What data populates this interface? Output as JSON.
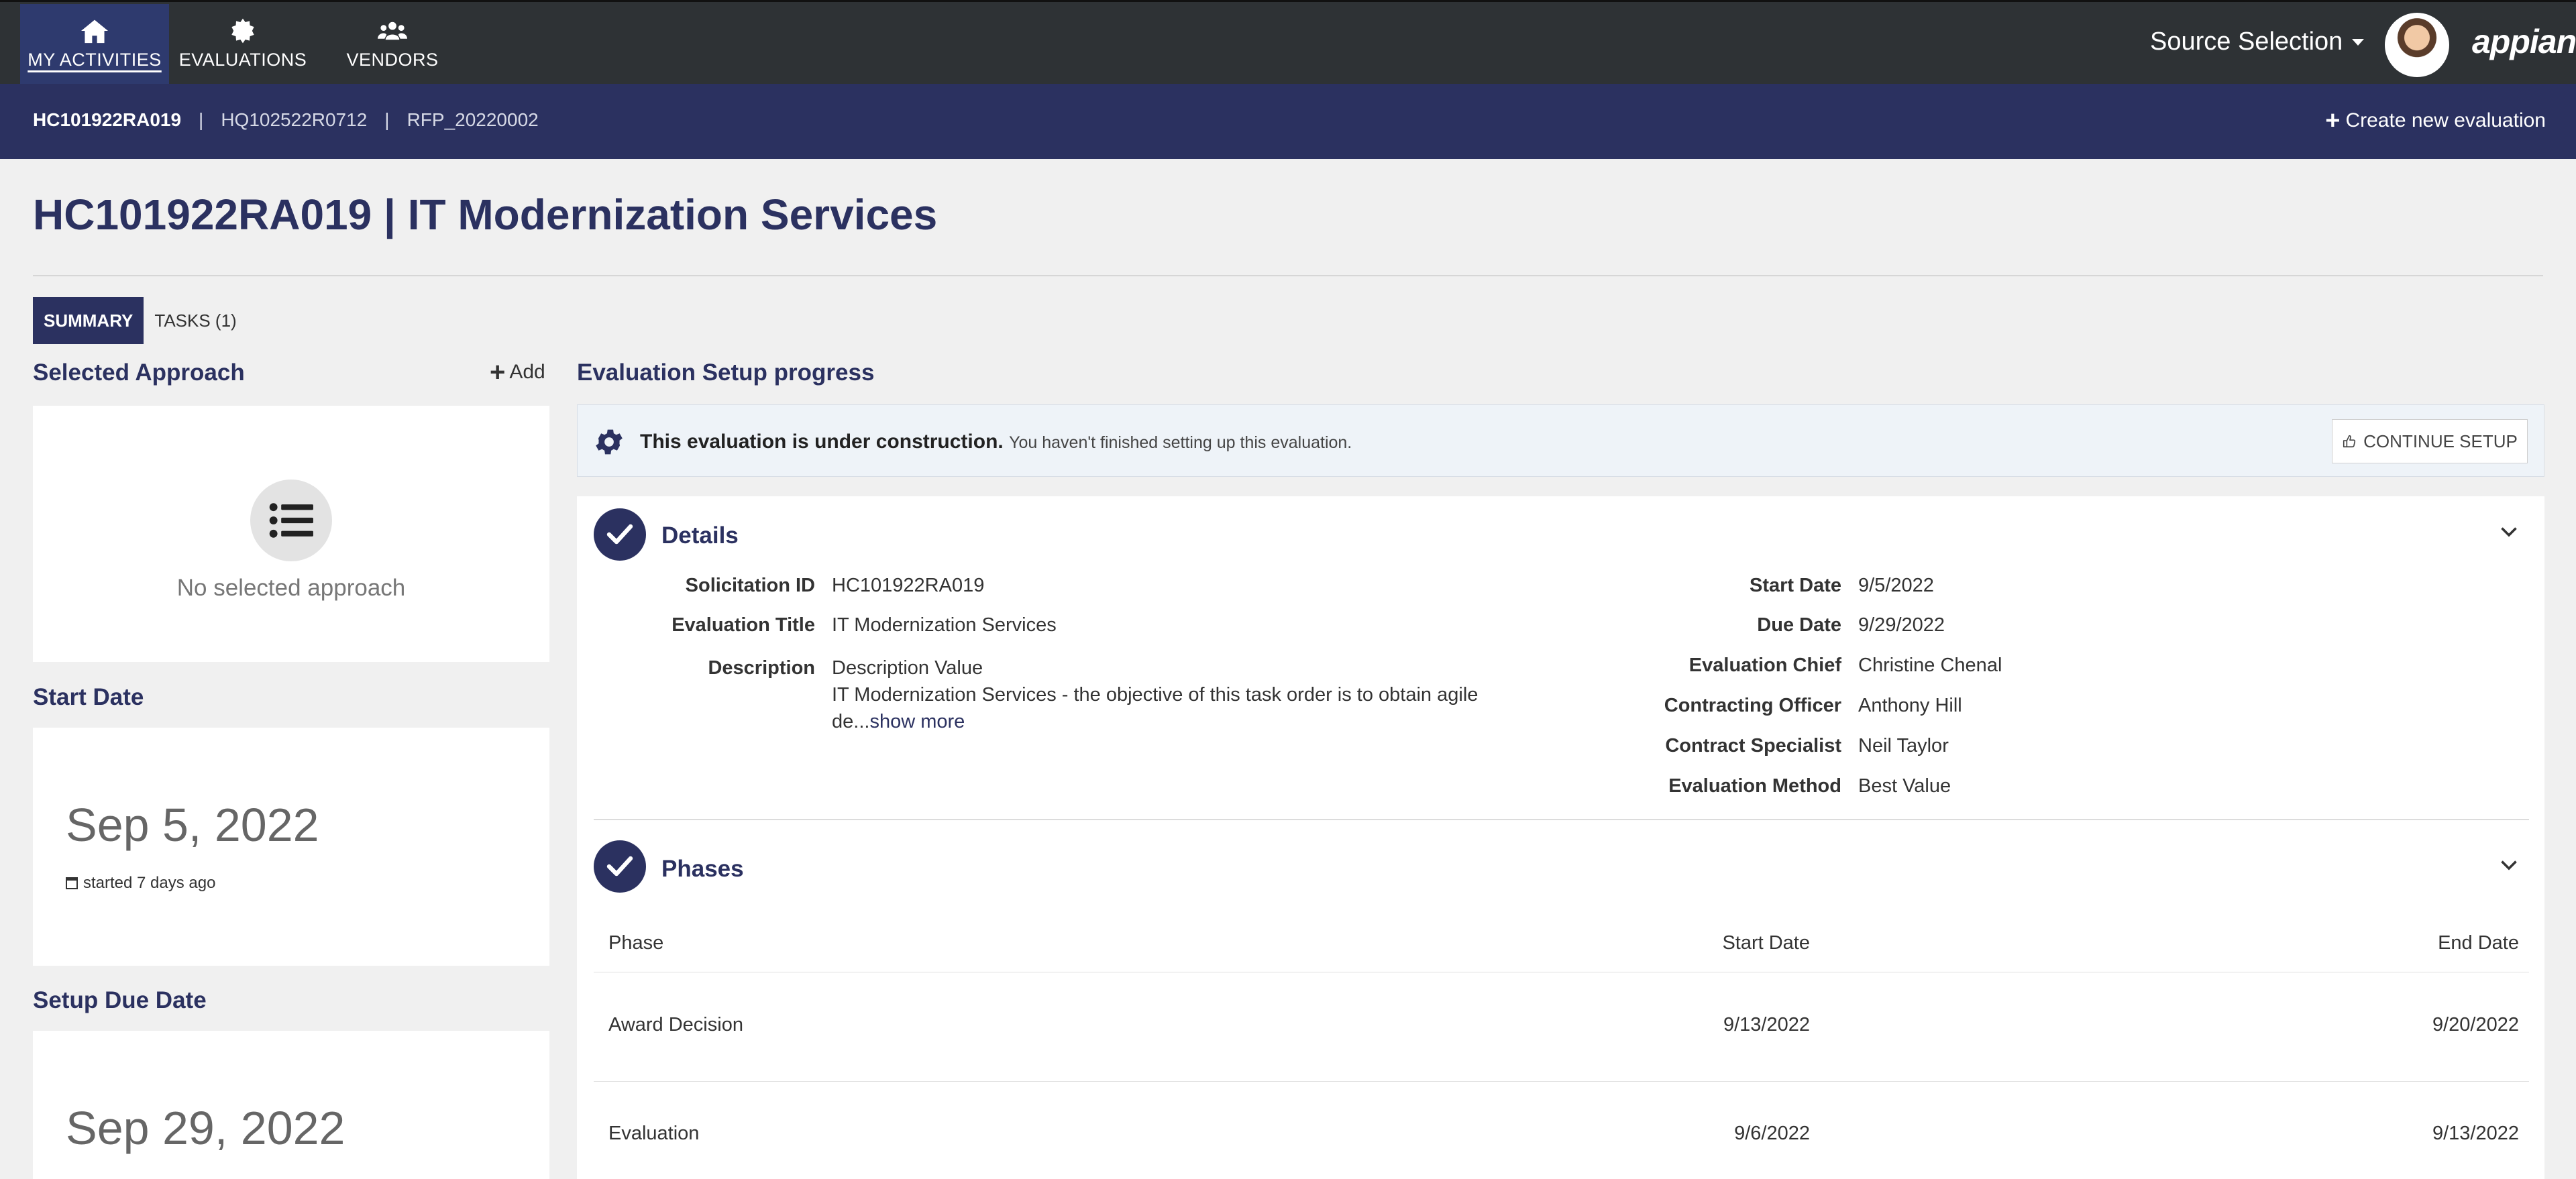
{
  "nav": {
    "tabs": [
      {
        "label": "MY ACTIVITIES",
        "icon": "home-icon",
        "active": true
      },
      {
        "label": "EVALUATIONS",
        "icon": "badge-icon",
        "active": false
      },
      {
        "label": "VENDORS",
        "icon": "users-icon",
        "active": false
      }
    ],
    "site_menu": "Source Selection",
    "logo": "appian"
  },
  "breadcrumbs": {
    "items": [
      "HC101922RA019",
      "HQ102522R0712",
      "RFP_20220002"
    ],
    "separator": "|"
  },
  "create_new_label": "Create new evaluation",
  "page_title": "HC101922RA019 | IT Modernization Services",
  "tabs": [
    "SUMMARY",
    "TASKS (1)"
  ],
  "left": {
    "approach_heading": "Selected Approach",
    "add_label": "Add",
    "no_approach": "No selected approach",
    "start_heading": "Start Date",
    "start_date": "Sep 5, 2022",
    "started_ago": "started 7 days ago",
    "due_heading": "Setup Due Date",
    "due_date": "Sep 29, 2022"
  },
  "progress": {
    "heading": "Evaluation Setup progress",
    "banner_bold": "This evaluation is under construction.",
    "banner_text": "You haven't finished setting up this evaluation.",
    "continue_label": "CONTINUE SETUP"
  },
  "details": {
    "title": "Details",
    "left": [
      {
        "label": "Solicitation ID",
        "value": "HC101922RA019"
      },
      {
        "label": "Evaluation Title",
        "value": "IT Modernization Services"
      }
    ],
    "description_label": "Description",
    "description_line1": "Description Value",
    "description_line2": "IT Modernization Services - the objective of this task order is to obtain agile",
    "description_line3": "de...",
    "show_more": "show more",
    "right": [
      {
        "label": "Start Date",
        "value": "9/5/2022"
      },
      {
        "label": "Due Date",
        "value": "9/29/2022"
      },
      {
        "label": "Evaluation Chief",
        "value": "Christine Chenal"
      },
      {
        "label": "Contracting Officer",
        "value": "Anthony Hill"
      },
      {
        "label": "Contract Specialist",
        "value": "Neil Taylor"
      },
      {
        "label": "Evaluation Method",
        "value": "Best Value"
      }
    ]
  },
  "phases": {
    "title": "Phases",
    "columns": [
      "Phase",
      "Start Date",
      "End Date"
    ],
    "rows": [
      {
        "phase": "Award Decision",
        "start": "9/13/2022",
        "end": "9/20/2022"
      },
      {
        "phase": "Evaluation",
        "start": "9/6/2022",
        "end": "9/13/2022"
      }
    ]
  },
  "colors": {
    "nav_bg": "#2e3235",
    "primary": "#2b3160",
    "banner_bg": "#eef3f8"
  }
}
